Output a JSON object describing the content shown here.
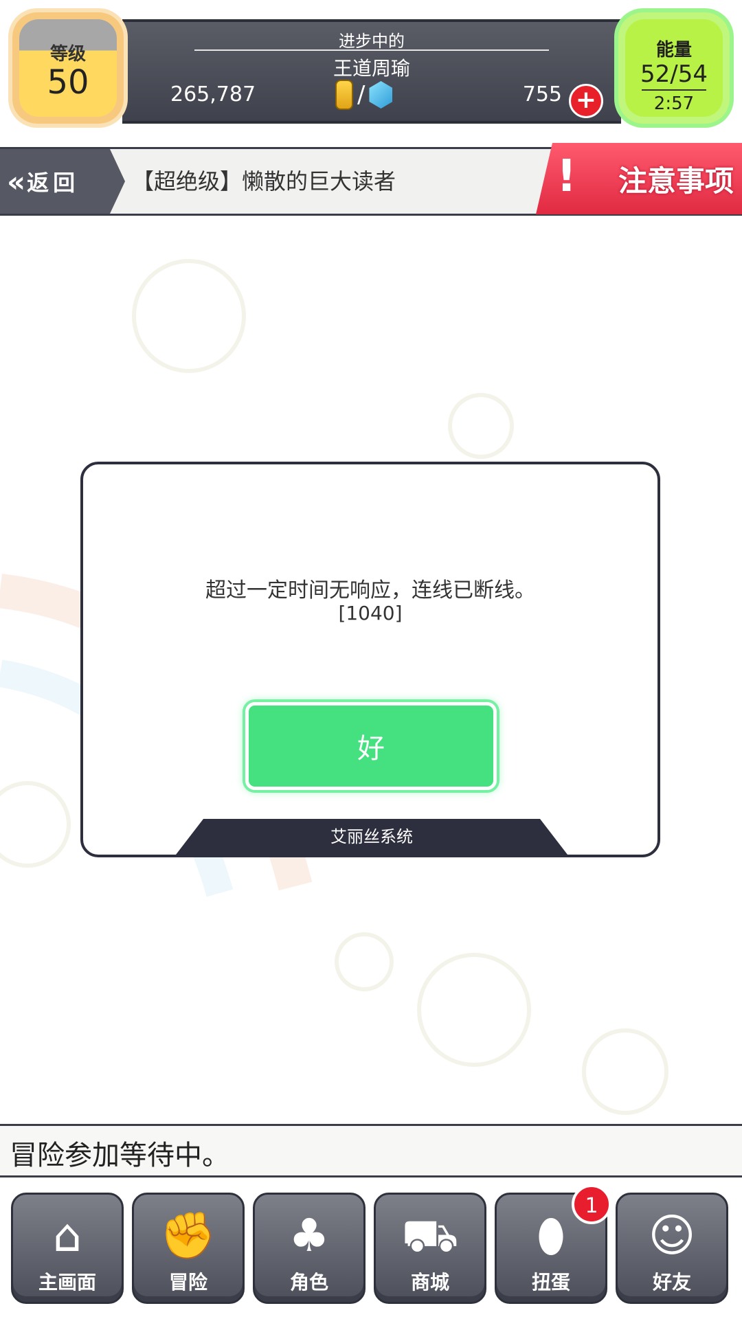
{
  "header": {
    "level_label": "等级",
    "level_value": "50",
    "status_text": "进步中的",
    "player_name": "王道周瑜",
    "gold": "265,787",
    "gems": "755",
    "energy_label": "能量",
    "energy_value": "52/54",
    "energy_timer": "2:57"
  },
  "subheader": {
    "back_label": "返回",
    "quest_title": "【超绝级】懒散的巨大读者",
    "notice_label": "注意事项"
  },
  "dialog": {
    "message": "超过一定时间无响应，连线已断线。",
    "code": "[1040]",
    "ok_label": "好",
    "footer": "艾丽丝系统"
  },
  "status_strip": {
    "text": "冒险参加等待中。"
  },
  "nav": [
    {
      "label": "主画面",
      "icon": "home-icon"
    },
    {
      "label": "冒险",
      "icon": "handshake-icon"
    },
    {
      "label": "角色",
      "icon": "rabbit-icon"
    },
    {
      "label": "商城",
      "icon": "cart-icon"
    },
    {
      "label": "扭蛋",
      "icon": "egg-icon"
    },
    {
      "label": "好友",
      "icon": "friends-icon"
    }
  ],
  "gacha_badge": "1",
  "colors": {
    "ok_green": "#45e080",
    "energy_green": "#b9f246",
    "level_yellow": "#ffd860",
    "notice_red": "#e02a42"
  }
}
